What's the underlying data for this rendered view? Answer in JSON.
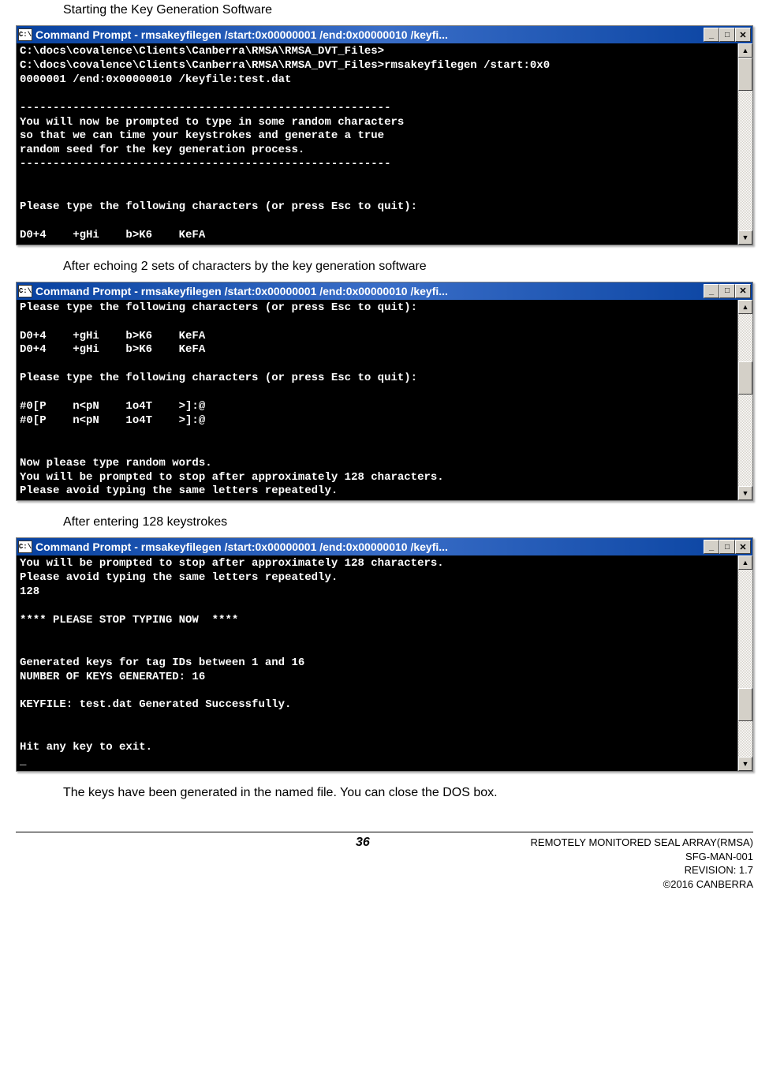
{
  "captions": {
    "c1": "Starting the Key Generation Software",
    "c2": "After echoing 2 sets of characters by the key generation software",
    "c3": "After entering 128 keystrokes",
    "c4": "The keys have been generated in the named file.  You can close the DOS box."
  },
  "titlebar": {
    "icon_text": "C:\\",
    "title": "Command Prompt - rmsakeyfilegen /start:0x00000001 /end:0x00000010 /keyfi...",
    "min": "_",
    "max": "□",
    "close": "✕"
  },
  "scroll": {
    "up": "▲",
    "down": "▼"
  },
  "terminals": {
    "t1": "C:\\docs\\covalence\\Clients\\Canberra\\RMSA\\RMSA_DVT_Files>\nC:\\docs\\covalence\\Clients\\Canberra\\RMSA\\RMSA_DVT_Files>rmsakeyfilegen /start:0x0\n0000001 /end:0x00000010 /keyfile:test.dat\n\n--------------------------------------------------------\nYou will now be prompted to type in some random characters\nso that we can time your keystrokes and generate a true\nrandom seed for the key generation process.\n--------------------------------------------------------\n\n\nPlease type the following characters (or press Esc to quit):\n\nD0+4    +gHi    b>K6    KeFA",
    "t2": "Please type the following characters (or press Esc to quit):\n\nD0+4    +gHi    b>K6    KeFA\nD0+4    +gHi    b>K6    KeFA\n\nPlease type the following characters (or press Esc to quit):\n\n#0[P    n<pN    1o4T    >]:@\n#0[P    n<pN    1o4T    >]:@\n\n\nNow please type random words.\nYou will be prompted to stop after approximately 128 characters.\nPlease avoid typing the same letters repeatedly.",
    "t3": "You will be prompted to stop after approximately 128 characters.\nPlease avoid typing the same letters repeatedly.\n128\n\n**** PLEASE STOP TYPING NOW  ****\n\n\nGenerated keys for tag IDs between 1 and 16\nNUMBER OF KEYS GENERATED: 16\n\nKEYFILE: test.dat Generated Successfully.\n\n\nHit any key to exit.\n_"
  },
  "thumb_top": {
    "t1": "0px",
    "t2": "60px",
    "t3": "150px"
  },
  "footer": {
    "page": "36",
    "line1": "REMOTELY MONITORED SEAL ARRAY(RMSA)",
    "line2": "SFG-MAN-001",
    "line3": "REVISION: 1.7",
    "line4": "©2016 CANBERRA"
  }
}
